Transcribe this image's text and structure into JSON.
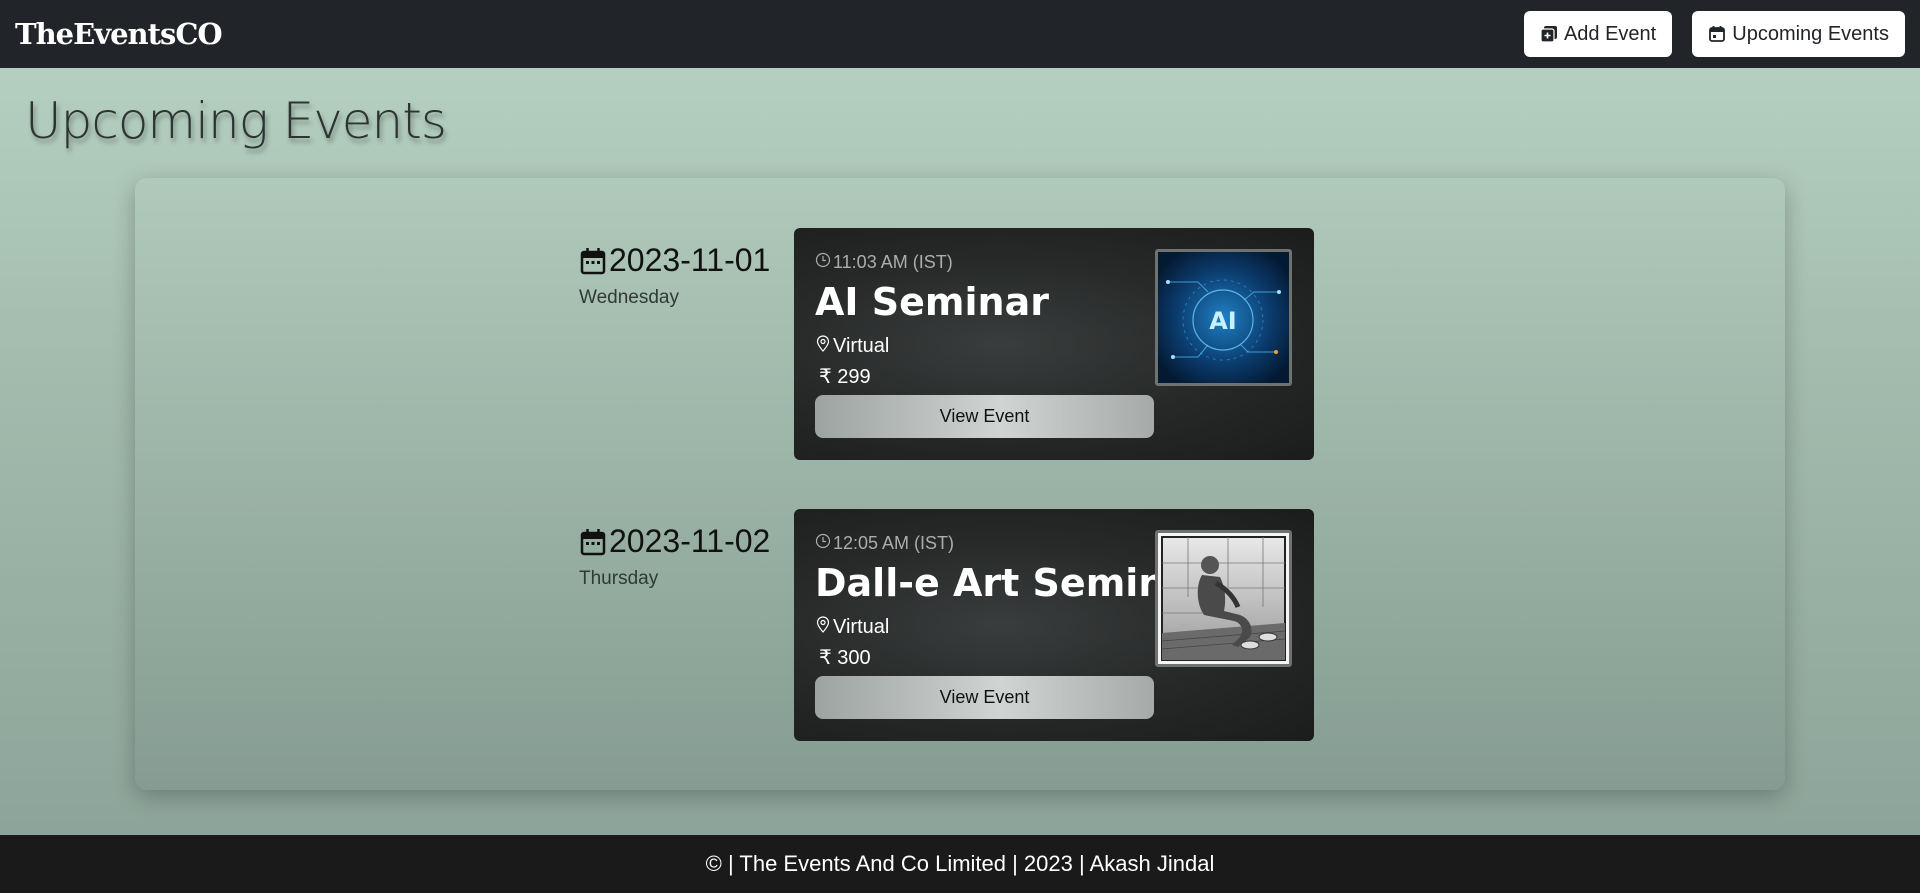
{
  "navbar": {
    "brand": "TheEventsCO",
    "add_event_label": "Add Event",
    "upcoming_events_label": "Upcoming Events"
  },
  "page": {
    "title": "Upcoming Events"
  },
  "events": [
    {
      "date": "2023-11-01",
      "day": "Wednesday",
      "time": "11:03 AM (IST)",
      "title": "AI Seminar",
      "venue": "Virtual",
      "price": "₹ 299",
      "button_label": "View Event",
      "image_icon": "ai-circuit-image",
      "image_label": "AI"
    },
    {
      "date": "2023-11-02",
      "day": "Thursday",
      "time": "12:05 AM (IST)",
      "title": "Dall-e Art Seminar",
      "venue": "Virtual",
      "price": "₹ 300",
      "button_label": "View Event",
      "image_icon": "seated-person-sketch-image"
    }
  ],
  "footer": {
    "text": "© | The Events And Co Limited | 2023 | Akash Jindal"
  },
  "colors": {
    "navbar_bg": "#212529",
    "card_bg": "#262828",
    "footer_bg": "#1a1a1a"
  }
}
